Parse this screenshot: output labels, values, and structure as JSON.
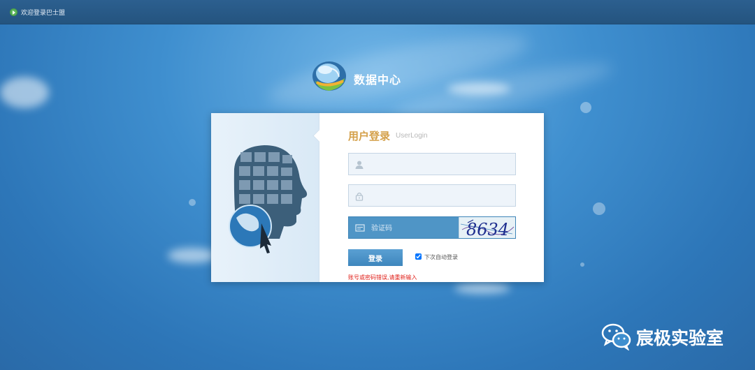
{
  "topbar": {
    "welcome_text": "欢迎登录巴士盟"
  },
  "brand": {
    "title": "数据中心"
  },
  "login": {
    "title": "用户登录",
    "subtitle": "UserLogin",
    "username": {
      "value": "",
      "placeholder": ""
    },
    "password": {
      "value": "",
      "placeholder": ""
    },
    "captcha": {
      "placeholder": "验证码",
      "image_text": "8634"
    },
    "submit_label": "登录",
    "remember": {
      "label": "下次自动登录",
      "checked": true
    },
    "error_message": "账号或密码错误,请重新输入"
  },
  "watermark": {
    "text": "宸极实验室"
  },
  "colors": {
    "accent": "#4f95c6",
    "title_gold": "#d4a04a",
    "error": "#e0201a"
  }
}
